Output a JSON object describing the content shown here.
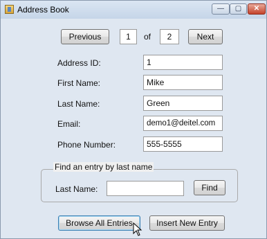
{
  "window": {
    "title": "Address Book",
    "controls": {
      "minimize": "—",
      "maximize": "▢",
      "close": "✕"
    }
  },
  "nav": {
    "previous_label": "Previous",
    "current_index": "1",
    "of_label": "of",
    "total_count": "2",
    "next_label": "Next"
  },
  "form": {
    "address_id_label": "Address ID:",
    "address_id": "1",
    "first_name_label": "First Name:",
    "first_name": "Mike",
    "last_name_label": "Last Name:",
    "last_name": "Green",
    "email_label": "Email:",
    "email": "demo1@deitel.com",
    "phone_label": "Phone Number:",
    "phone": "555-5555"
  },
  "find": {
    "group_title": "Find an entry by last name",
    "last_name_label": "Last Name:",
    "last_name_value": "",
    "find_label": "Find"
  },
  "actions": {
    "browse_label": "Browse All Entries",
    "insert_label": "Insert New Entry"
  }
}
